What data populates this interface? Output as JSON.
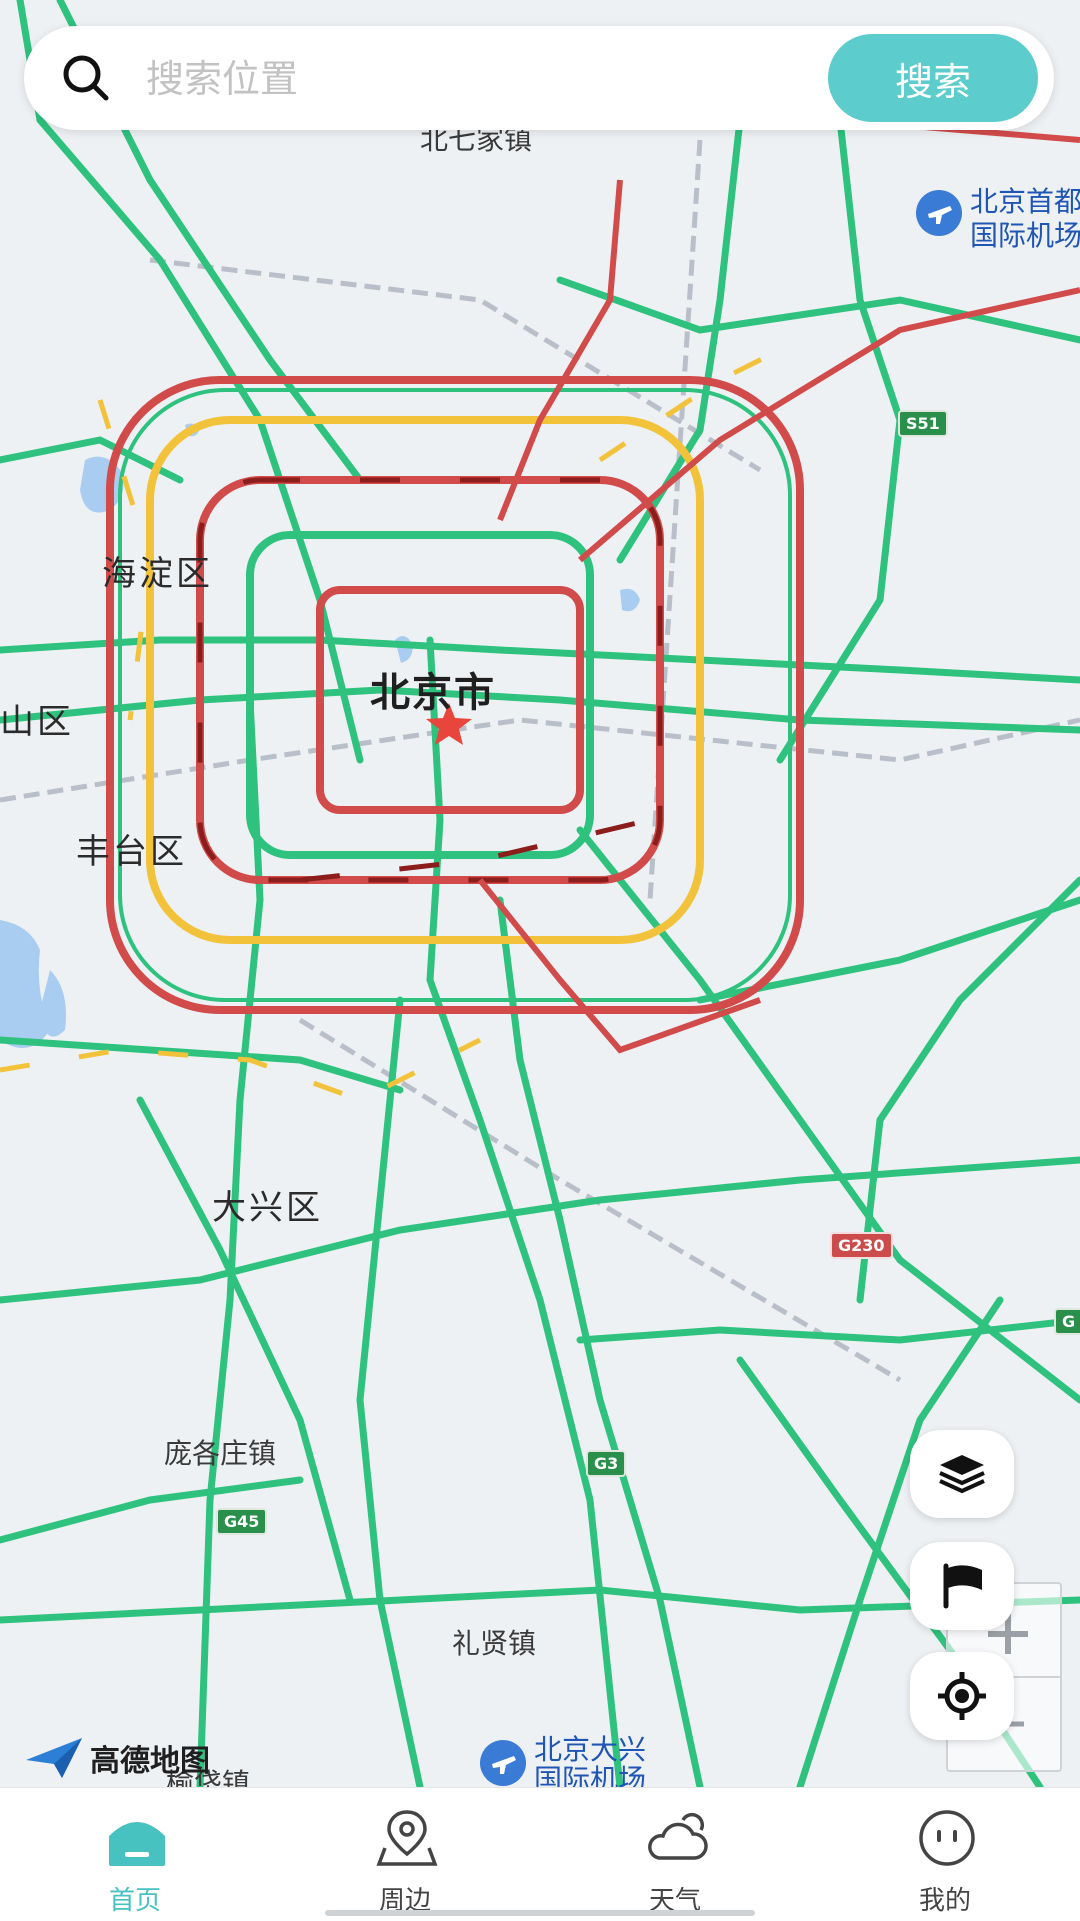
{
  "search": {
    "placeholder": "搜索位置",
    "button_label": "搜索"
  },
  "map": {
    "center_label": "北京市",
    "districts": {
      "haidian": "海淀区",
      "fengtai": "丰台区",
      "daxing": "大兴区",
      "shijingshan_partial": "山区"
    },
    "towns": {
      "beiqijia": "北七家镇",
      "panggezhuang": "庞各庄镇",
      "lixian": "礼贤镇",
      "yufa": "榆垡镇"
    },
    "airports": {
      "capital_line1": "北京首都",
      "capital_line2": "国际机场",
      "daxing_line1": "北京大兴",
      "daxing_line2": "国际机场"
    },
    "shields": {
      "s51": "S51",
      "g230": "G230",
      "g3": "G3",
      "g45": "G45",
      "g_right": "G"
    },
    "brand": "高德地图"
  },
  "colors": {
    "accent": "#5ccdcc",
    "road_green": "#2ec27e",
    "road_yellow": "#f2c23a",
    "road_red": "#d24b4b",
    "road_darkred": "#8b1d1d"
  },
  "controls": {
    "layers_icon": "layers-icon",
    "flag_icon": "flag-icon",
    "locate_icon": "locate-icon"
  },
  "tabs": [
    {
      "label": "首页",
      "icon": "home-icon",
      "active": true
    },
    {
      "label": "周边",
      "icon": "nearby-icon",
      "active": false
    },
    {
      "label": "天气",
      "icon": "weather-icon",
      "active": false
    },
    {
      "label": "我的",
      "icon": "profile-icon",
      "active": false
    }
  ]
}
